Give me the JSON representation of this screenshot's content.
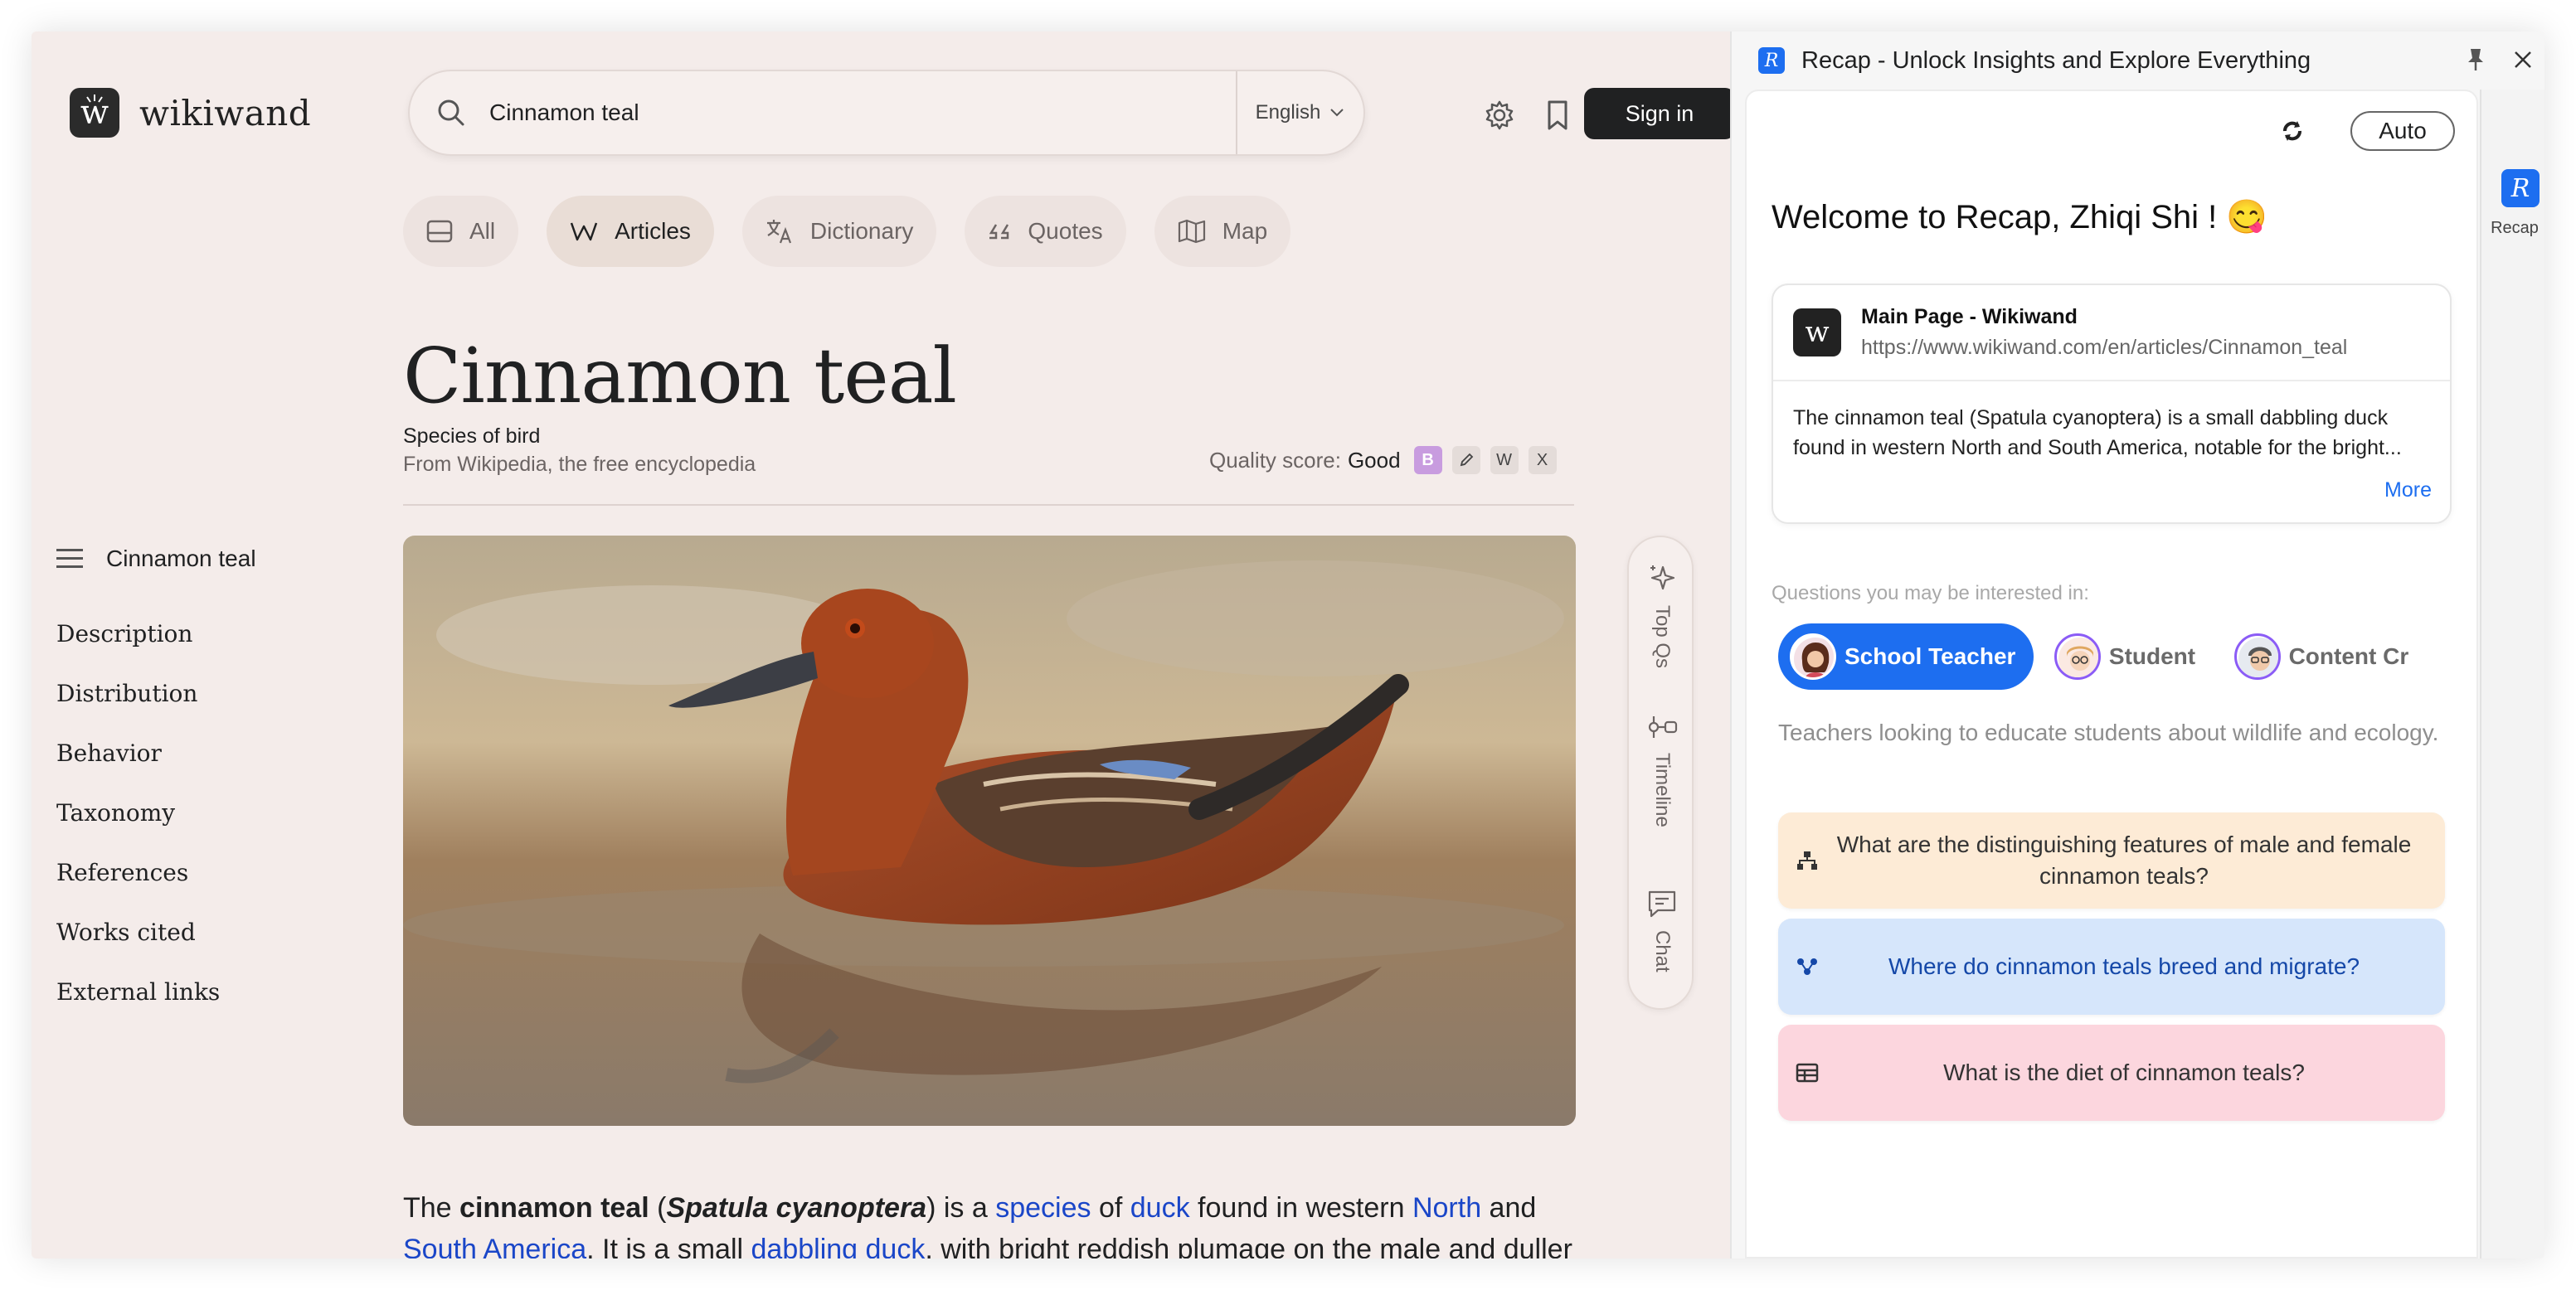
{
  "wikiwand": {
    "logo_text": "wikiwand",
    "search": {
      "value": "Cinnamon teal",
      "language": "English"
    },
    "sign_in": "Sign in",
    "tabs": [
      {
        "label": "All",
        "icon": "all-icon"
      },
      {
        "label": "Articles",
        "icon": "articles-icon",
        "active": true
      },
      {
        "label": "Dictionary",
        "icon": "translate-icon"
      },
      {
        "label": "Quotes",
        "icon": "quote-icon"
      },
      {
        "label": "Map",
        "icon": "map-icon"
      }
    ],
    "article": {
      "title": "Cinnamon teal",
      "subtitle": "Species of bird",
      "source": "From Wikipedia, the free encyclopedia",
      "quality_label": "Quality score:",
      "quality_value": "Good",
      "quality_badges": [
        "B",
        "W",
        "X"
      ]
    },
    "toc": {
      "heading": "Cinnamon teal",
      "items": [
        "Description",
        "Distribution",
        "Behavior",
        "Taxonomy",
        "References",
        "Works cited",
        "External links"
      ]
    },
    "rail": [
      "Top Qs",
      "Timeline",
      "Chat"
    ],
    "paragraph": {
      "t1": "The ",
      "b1": "cinnamon teal",
      "t2": " (",
      "bi1": "Spatula cyanoptera",
      "t3": ") is a ",
      "l1": "species",
      "t4": " of ",
      "l2": "duck",
      "t5": " found in western ",
      "l3": "North",
      "t6": " and ",
      "l4": "South America",
      "t7": ". It is a small ",
      "l5": "dabbling duck",
      "t8": ", with bright reddish plumage on the male and duller brown"
    }
  },
  "recap": {
    "title": "Recap - Unlock Insights and Explore Everything",
    "mode": "Auto",
    "welcome": "Welcome to Recap, Zhiqi Shi ! 😋",
    "card": {
      "title": "Main Page - Wikiwand",
      "url": "https://www.wikiwand.com/en/articles/Cinnamon_teal",
      "summary": "The cinnamon teal (Spatula cyanoptera) is a small dabbling duck found in western North and South America, notable for the bright...",
      "more": "More"
    },
    "questions_label": "Questions you may be interested in:",
    "personas": [
      {
        "label": "School Teacher",
        "active": true
      },
      {
        "label": "Student",
        "active": false
      },
      {
        "label": "Content Cr",
        "active": false
      }
    ],
    "persona_desc": "Teachers looking to educate students about wildlife and ecology.",
    "questions": [
      "What are the distinguishing features of male and female cinnamon teals?",
      "Where do cinnamon teals breed and migrate?",
      "What is the diet of cinnamon teals?"
    ],
    "side_label": "Recap"
  },
  "colors": {
    "accent": "#1d6ef0",
    "wiki_bg": "#f4ecea",
    "link": "#1a46c8"
  }
}
